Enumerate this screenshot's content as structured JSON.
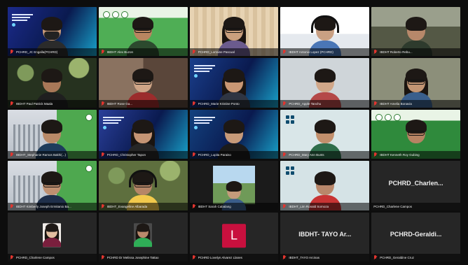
{
  "meeting": {
    "participants": [
      {
        "name": "PCHRD_JC Engalla(PCHRD)",
        "muted": true,
        "bg": "#1b2a8a",
        "vbg": "research",
        "person": {
          "skin": "#c99a78",
          "shirt": "#2b2b2b",
          "mask": true
        }
      },
      {
        "name": "IBDHT Alex Buzon",
        "muted": true,
        "bg": "#4fae55",
        "vbg": "logos",
        "person": {
          "skin": "#b98560",
          "shirt": "#2c4a2e",
          "glasses": true
        }
      },
      {
        "name": "PCHRD_Lorraine Pascual",
        "muted": true,
        "bg": "#e6d2b1",
        "vbg": "curtain",
        "person": {
          "skin": "#caa07e",
          "shirt": "#6b5b8d",
          "glasses": true,
          "longhair": true
        }
      },
      {
        "name": "IBDHT Antonio Lopez (PCHRD)",
        "muted": true,
        "bg": "#ffffff",
        "vbg": "room",
        "person": {
          "skin": "#c9a083",
          "shirt": "#4a76b6",
          "headset": true
        }
      },
      {
        "name": "IBDHT Roberto Rebu...",
        "muted": true,
        "bg": "#6b705c",
        "vbg": "office",
        "person": {
          "skin": "#b7886a",
          "shirt": "#2e3b2d"
        }
      },
      {
        "name": "IBDHT Paul Patrick Maala",
        "muted": true,
        "bg": "#26321f",
        "vbg": "foliage",
        "person": {
          "skin": "#a87858",
          "shirt": "#1f1f1f"
        }
      },
      {
        "name": "IBDHT Rose Ga...",
        "muted": true,
        "bg": "#6a5546",
        "vbg": "home",
        "person": {
          "skin": "#cfa587",
          "shirt": "#9b2c2c",
          "glasses": true
        }
      },
      {
        "name": "PCHRD_Marie Kristine Ponto",
        "muted": true,
        "bg": "#1a3f8c",
        "vbg": "research",
        "active": true,
        "person": {
          "skin": "#c99774",
          "shirt": "#2f3542",
          "longhair": true
        }
      },
      {
        "name": "PCHRD_Apple Tanchu",
        "muted": true,
        "bg": "#cfd5d9",
        "vbg": "plain",
        "person": {
          "skin": "#d1a789",
          "shirt": "#b44848"
        }
      },
      {
        "name": "IBDHT Amelia Bonavia",
        "muted": true,
        "bg": "#8c8f7a",
        "vbg": "plain",
        "person": {
          "skin": "#c29573",
          "shirt": "#3a5f8c",
          "glasses": true,
          "longhair": true
        }
      },
      {
        "name": "IBDHT_Stephanie Ramos Bakhi(...)",
        "muted": true,
        "bg": "#4ea84f",
        "vbg": "building",
        "person": {
          "skin": "#b98a68",
          "shirt": "#1e3d5c"
        }
      },
      {
        "name": "PCHRD_Christopher Tapon",
        "muted": true,
        "bg": "#2a3f9a",
        "vbg": "research",
        "person": {
          "skin": "#c49474",
          "shirt": "#262626",
          "longhair": true
        }
      },
      {
        "name": "PCHRD_Lupita Paraiso",
        "muted": true,
        "bg": "#13427f",
        "vbg": "research",
        "person": {
          "skin": "#c79a79",
          "shirt": "#1b1b1b"
        }
      },
      {
        "name": "PCHRD_Mary Ann Bunts",
        "muted": true,
        "bg": "#d9e6e8",
        "vbg": "gridlogo",
        "person": {
          "skin": "#c28f6c",
          "shirt": "#2e6d4a"
        }
      },
      {
        "name": "IBDHT Kenneth Roy Gubing",
        "muted": true,
        "bg": "#2f8a3c",
        "vbg": "logos",
        "person": {
          "skin": "#b68363",
          "shirt": "#2f8a3c",
          "glasses": true
        }
      },
      {
        "name": "IBDHT Kimberly Joseph Ermitanio Ba...",
        "muted": true,
        "bg": "#4ea84f",
        "vbg": "building",
        "person": {
          "skin": "#c09070",
          "shirt": "#1f2f4a",
          "glasses": true
        }
      },
      {
        "name": "IBDHT_Evangeline Albarada",
        "muted": true,
        "bg": "#5e6f3e",
        "vbg": "foliage",
        "person": {
          "skin": "#b68667",
          "shirt": "#f2c94c",
          "glasses": true,
          "headset": true
        }
      },
      {
        "name": "IBDHT Sarah Cabalang",
        "muted": true,
        "bg": "#1b1b1b",
        "vbg": "photo",
        "person": {
          "skin": "#c49b7b",
          "shirt": "#3a5d8a"
        }
      },
      {
        "name": "IBDHT_Lim Ronald Sornoza",
        "muted": true,
        "bg": "#d5e3e6",
        "vbg": "gridlogo",
        "person": {
          "skin": "#b9876a",
          "shirt": "#c83434"
        }
      },
      {
        "name": "PCHRD_Charlene Campos",
        "muted": false,
        "bg": "#262626",
        "vbg": "name",
        "display": "PCHRD_Charlen..."
      },
      {
        "name": "PCHRD_Charlene Campos",
        "muted": true,
        "bg": "#262626",
        "vbg": "photothumb",
        "person": {
          "skin": "#e2bea0",
          "shirt": "#7a1f3d",
          "longhair": true
        }
      },
      {
        "name": "PCHRD Dr Melissa Josephine Tattao",
        "muted": true,
        "bg": "#262626",
        "vbg": "photothumb",
        "person": {
          "skin": "#b98a6c",
          "shirt": "#2fae57",
          "longhair": true
        }
      },
      {
        "name": "PCHRD Lovelyn Alvarez Llanes",
        "muted": true,
        "bg": "#262626",
        "vbg": "avatar",
        "display": "L"
      },
      {
        "name": "IBDHT_TAYO Arcinas",
        "muted": true,
        "bg": "#262626",
        "vbg": "name",
        "display": "IBDHT- TAYO Ar..."
      },
      {
        "name": "PCHRD_Geraldine Cruz",
        "muted": true,
        "bg": "#262626",
        "vbg": "name",
        "display": "PCHRD-Geraldi..."
      }
    ]
  }
}
